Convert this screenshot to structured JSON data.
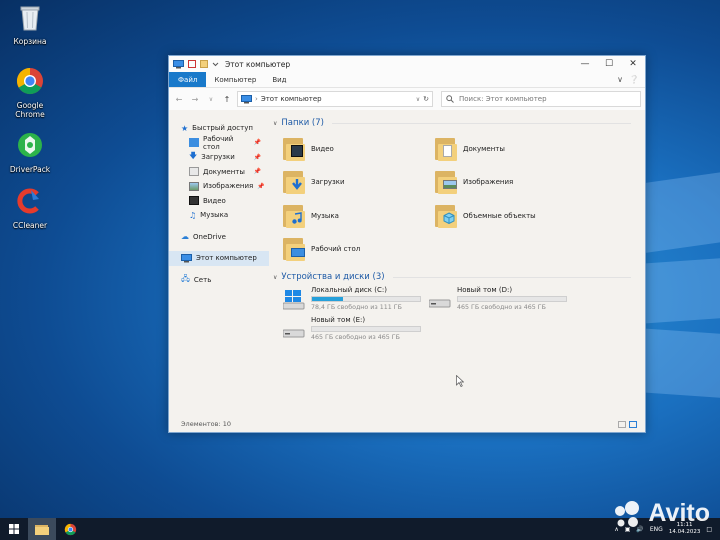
{
  "desktop": {
    "icons": [
      {
        "label": "Корзина"
      },
      {
        "label": "Google Chrome"
      },
      {
        "label": "DriverPack"
      },
      {
        "label": "CCleaner"
      }
    ]
  },
  "window": {
    "title": "Этот компьютер",
    "ribbon_tabs": [
      "Файл",
      "Компьютер",
      "Вид"
    ],
    "address_path": "Этот компьютер",
    "search_placeholder": "Поиск: Этот компьютер"
  },
  "nav": {
    "quick_access": "Быстрый доступ",
    "items": [
      {
        "label": "Рабочий стол",
        "pinned": true
      },
      {
        "label": "Загрузки",
        "pinned": true
      },
      {
        "label": "Документы",
        "pinned": true
      },
      {
        "label": "Изображения",
        "pinned": true
      },
      {
        "label": "Видео",
        "pinned": false
      },
      {
        "label": "Музыка",
        "pinned": false
      }
    ],
    "onedrive": "OneDrive",
    "this_pc": "Этот компьютер",
    "network": "Сеть"
  },
  "folders_group": {
    "title": "Папки (7)",
    "items": [
      {
        "label": "Видео"
      },
      {
        "label": "Документы"
      },
      {
        "label": "Загрузки"
      },
      {
        "label": "Изображения"
      },
      {
        "label": "Музыка"
      },
      {
        "label": "Объемные объекты"
      },
      {
        "label": "Рабочий стол"
      }
    ]
  },
  "drives_group": {
    "title": "Устройства и диски (3)",
    "items": [
      {
        "name": "Локальный диск (C:)",
        "free": "78,4 ГБ свободно из 111 ГБ",
        "used_fraction": 0.29
      },
      {
        "name": "Новый том (D:)",
        "free": "465 ГБ свободно из 465 ГБ",
        "used_fraction": 0.0
      },
      {
        "name": "Новый том (E:)",
        "free": "465 ГБ свободно из 465 ГБ",
        "used_fraction": 0.0
      }
    ]
  },
  "status": {
    "items": "Элементов: 10"
  },
  "taskbar": {
    "lang": "ENG",
    "time": "11:11",
    "date": "14.04.2023"
  },
  "watermark": {
    "text": "Avito"
  },
  "colors": {
    "accent": "#1979ca",
    "drive_fill": "#26a0da",
    "group_header": "#1e5aa6"
  }
}
